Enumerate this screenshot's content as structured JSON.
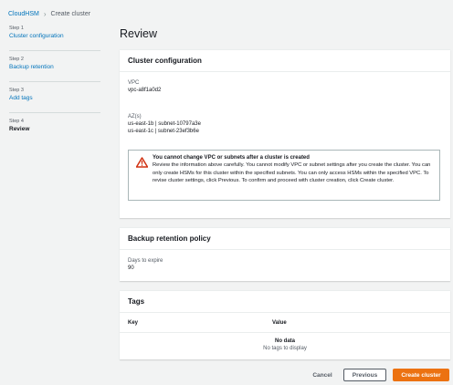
{
  "breadcrumb": {
    "root": "CloudHSM",
    "current": "Create cluster"
  },
  "steps": [
    {
      "step": "Step 1",
      "label": "Cluster configuration"
    },
    {
      "step": "Step 2",
      "label": "Backup retention"
    },
    {
      "step": "Step 3",
      "label": "Add tags"
    },
    {
      "step": "Step 4",
      "label": "Review"
    }
  ],
  "page_title": "Review",
  "cluster_config": {
    "title": "Cluster configuration",
    "vpc_label": "VPC",
    "vpc_value": "vpc-a8f1a0d2",
    "azs_label": "AZ(s)",
    "azs": [
      "us-east-1b | subnet-10797a3e",
      "us-east-1c | subnet-23ef3b6e"
    ],
    "warning_title": "You cannot change VPC or subnets after a cluster is created",
    "warning_body": "Review the information above carefully. You cannot modify VPC or subnet settings after you create the cluster. You can only create HSMs for this cluster within the specified subnets. You can only access HSMs within the specified VPC. To revise cluster settings, click Previous. To confirm and proceed with cluster creation, click Create cluster."
  },
  "backup": {
    "title": "Backup retention policy",
    "days_label": "Days to expire",
    "days_value": "90"
  },
  "tags": {
    "title": "Tags",
    "col_key": "Key",
    "col_value": "Value",
    "empty_title": "No data",
    "empty_sub": "No tags to display"
  },
  "actions": {
    "cancel": "Cancel",
    "previous": "Previous",
    "create": "Create cluster"
  },
  "colors": {
    "accent": "#0073bb",
    "primary": "#ec7211",
    "warning": "#d13212"
  }
}
